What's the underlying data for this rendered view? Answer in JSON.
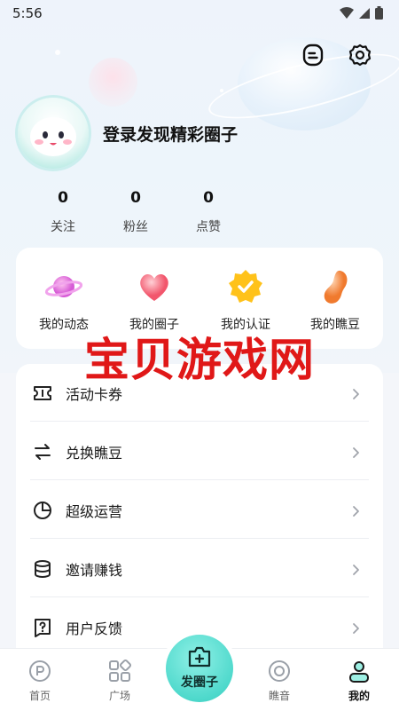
{
  "status_bar": {
    "time": "5:56"
  },
  "profile": {
    "login_prompt": "登录发现精彩圈子",
    "stats": [
      {
        "value": "0",
        "label": "关注"
      },
      {
        "value": "0",
        "label": "粉丝"
      },
      {
        "value": "0",
        "label": "点赞"
      }
    ]
  },
  "quick_actions": [
    {
      "label": "我的动态",
      "icon": "planet-icon"
    },
    {
      "label": "我的圈子",
      "icon": "heart-icon"
    },
    {
      "label": "我的认证",
      "icon": "verified-badge-icon"
    },
    {
      "label": "我的瞧豆",
      "icon": "bean-icon"
    }
  ],
  "menu": [
    {
      "label": "活动卡券",
      "icon": "ticket-icon"
    },
    {
      "label": "兑换瞧豆",
      "icon": "exchange-icon"
    },
    {
      "label": "超级运营",
      "icon": "pie-chart-icon"
    },
    {
      "label": "邀请赚钱",
      "icon": "coins-icon"
    },
    {
      "label": "用户反馈",
      "icon": "feedback-icon"
    }
  ],
  "watermark": "宝贝游戏网",
  "tabbar": {
    "tabs": [
      {
        "label": "首页",
        "icon": "home-icon"
      },
      {
        "label": "广场",
        "icon": "grid-icon"
      },
      {
        "label": "瞧音",
        "icon": "sound-icon"
      },
      {
        "label": "我的",
        "icon": "profile-icon",
        "active": true
      }
    ],
    "fab_label": "发圈子"
  },
  "colors": {
    "accent": "#4fd9cc",
    "watermark": "#e01818"
  }
}
